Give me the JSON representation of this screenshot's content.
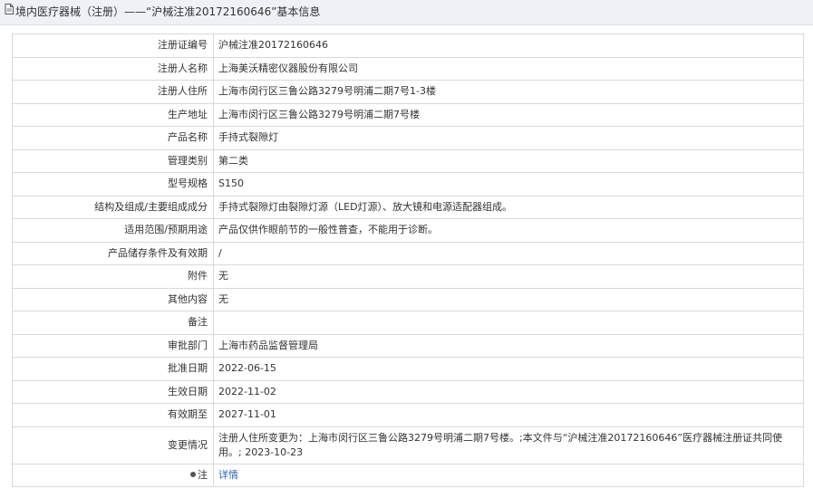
{
  "header": {
    "title": "境内医疗器械（注册）——“沪械注准20172160646”基本信息"
  },
  "rows": [
    {
      "label": "注册证编号",
      "value": "沪械注准20172160646"
    },
    {
      "label": "注册人名称",
      "value": "上海美沃精密仪器股份有限公司"
    },
    {
      "label": "注册人住所",
      "value": "上海市闵行区三鲁公路3279号明浦二期7号1-3楼"
    },
    {
      "label": "生产地址",
      "value": "上海市闵行区三鲁公路3279号明浦二期7号楼"
    },
    {
      "label": "产品名称",
      "value": "手持式裂隙灯"
    },
    {
      "label": "管理类别",
      "value": "第二类"
    },
    {
      "label": "型号规格",
      "value": "S150"
    },
    {
      "label": "结构及组成/主要组成成分",
      "value": "手持式裂隙灯由裂隙灯源（LED灯源）、放大镜和电源适配器组成。"
    },
    {
      "label": "适用范围/预期用途",
      "value": "产品仅供作眼前节的一般性普查，不能用于诊断。"
    },
    {
      "label": "产品储存条件及有效期",
      "value": "/"
    },
    {
      "label": "附件",
      "value": "无"
    },
    {
      "label": "其他内容",
      "value": "无"
    },
    {
      "label": "备注",
      "value": ""
    },
    {
      "label": "审批部门",
      "value": "上海市药品监督管理局"
    },
    {
      "label": "批准日期",
      "value": "2022-06-15"
    },
    {
      "label": "生效日期",
      "value": "2022-11-02"
    },
    {
      "label": "有效期至",
      "value": "2027-11-01"
    },
    {
      "label": "变更情况",
      "value": "注册人住所变更为：上海市闵行区三鲁公路3279号明浦二期7号楼。;本文件与“沪械注准20172160646”医疗器械注册证共同使用。; 2023-10-23"
    }
  ],
  "note": {
    "label": "注",
    "link_text": "详情"
  },
  "colors": {
    "header_bg": "#eef1f5",
    "border": "#d9d9d9",
    "link": "#2f64b6"
  }
}
